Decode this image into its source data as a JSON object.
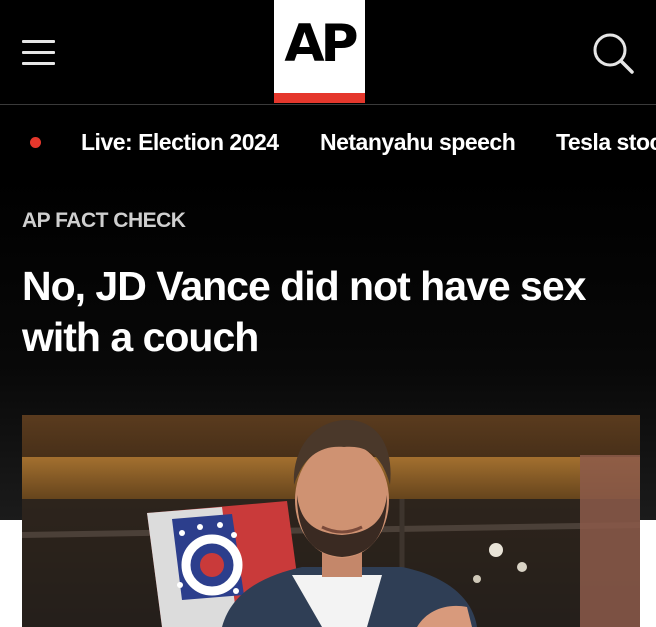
{
  "header": {
    "logo_text": "AP"
  },
  "trending": {
    "items": [
      {
        "label": "Live: Election 2024"
      },
      {
        "label": "Netanyahu speech"
      },
      {
        "label": "Tesla stoc"
      }
    ]
  },
  "article": {
    "kicker": "AP FACT CHECK",
    "headline": "No, JD Vance did not have sex with a couch"
  },
  "colors": {
    "accent_red": "#e5372c",
    "background": "#000000"
  },
  "icons": [
    "hamburger-menu-icon",
    "search-icon"
  ]
}
